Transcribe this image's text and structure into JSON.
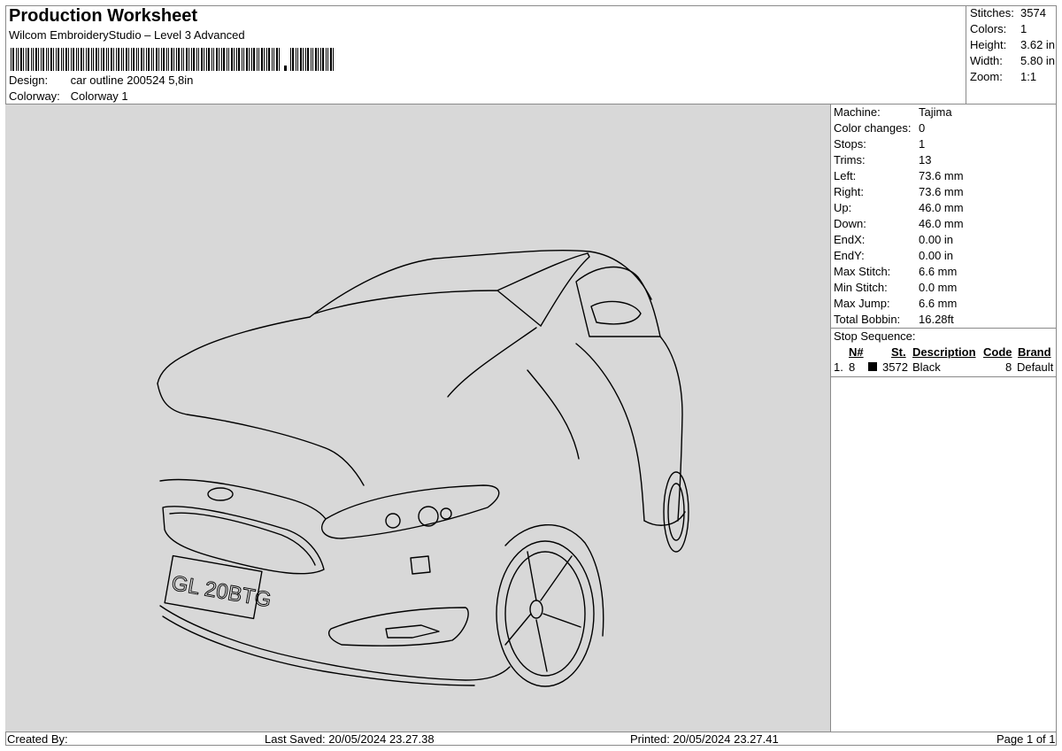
{
  "header": {
    "title": "Production Worksheet",
    "subtitle": "Wilcom EmbroideryStudio – Level 3 Advanced",
    "design_label": "Design:",
    "design_value": "car outline 200524 5,8in",
    "colorway_label": "Colorway:",
    "colorway_value": "Colorway 1"
  },
  "stats": {
    "stitches_label": "Stitches:",
    "stitches_value": "3574",
    "colors_label": "Colors:",
    "colors_value": "1",
    "height_label": "Height:",
    "height_value": "3.62 in",
    "width_label": "Width:",
    "width_value": "5.80 in",
    "zoom_label": "Zoom:",
    "zoom_value": "1:1"
  },
  "machine_info": [
    {
      "label": "Machine:",
      "value": "Tajima"
    },
    {
      "label": "Color changes:",
      "value": "0"
    },
    {
      "label": "Stops:",
      "value": "1"
    },
    {
      "label": "Trims:",
      "value": "13"
    },
    {
      "label": "Left:",
      "value": "73.6 mm"
    },
    {
      "label": "Right:",
      "value": "73.6 mm"
    },
    {
      "label": "Up:",
      "value": "46.0 mm"
    },
    {
      "label": "Down:",
      "value": "46.0 mm"
    },
    {
      "label": "EndX:",
      "value": "0.00 in"
    },
    {
      "label": "EndY:",
      "value": "0.00 in"
    },
    {
      "label": "Max Stitch:",
      "value": "6.6 mm"
    },
    {
      "label": "Min Stitch:",
      "value": "0.0 mm"
    },
    {
      "label": "Max Jump:",
      "value": "6.6 mm"
    },
    {
      "label": "Total Bobbin:",
      "value": "16.28ft"
    }
  ],
  "stop_sequence": {
    "title": "Stop Sequence:",
    "headers": {
      "n": "N#",
      "st": "St.",
      "description": "Description",
      "code": "Code",
      "brand": "Brand"
    },
    "rows": [
      {
        "index": "1.",
        "n": "8",
        "st": "3572",
        "description": "Black",
        "code": "8",
        "brand": "Default",
        "color": "#000000"
      }
    ]
  },
  "design": {
    "plate_text": "GL 20BTG",
    "thread_color": "#000000",
    "background_color": "#d8d8d8"
  },
  "footer": {
    "created_by": "Created By:",
    "last_saved": "Last Saved: 20/05/2024 23.27.38",
    "printed": "Printed: 20/05/2024 23.27.41",
    "page": "Page 1 of 1"
  }
}
